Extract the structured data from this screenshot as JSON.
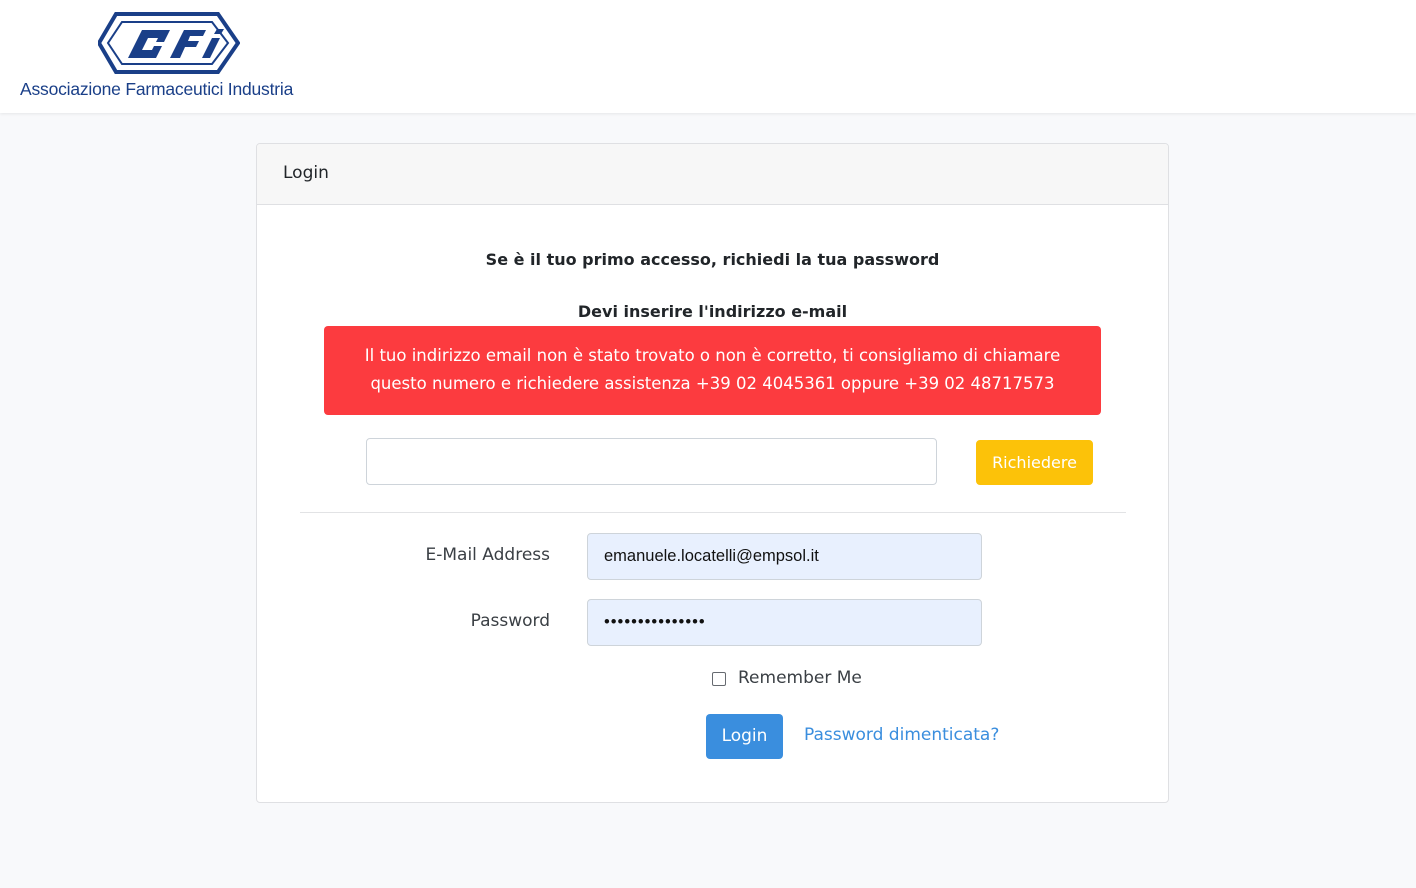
{
  "brand": {
    "logo_letters": "afi",
    "name": "Associazione Farmaceutici Industria",
    "color": "#1a3f88"
  },
  "card": {
    "header_title": "Login"
  },
  "request": {
    "first_access_text": "Se è il tuo primo accesso, richiedi la tua password",
    "must_enter_email_text": "Devi inserire l'indirizzo e-mail",
    "alert_text": "Il tuo indirizzo email non è stato trovato o non è corretto, ti consigliamo di chiamare questo numero e richiedere assistenza +39 02 4045361 oppure +39 02 48717573",
    "alert_color": "#fc3b3f",
    "email_value": "",
    "button_label": "Richiedere",
    "button_color": "#fcc209"
  },
  "login_form": {
    "email_label": "E-Mail Address",
    "email_value": "emanuele.locatelli@empsol.it",
    "password_label": "Password",
    "password_value": "•••••••••••••••",
    "remember_label": "Remember Me",
    "remember_checked": false,
    "login_button_label": "Login",
    "login_button_color": "#3a8ede",
    "forgot_link_text": "Password dimenticata?"
  }
}
